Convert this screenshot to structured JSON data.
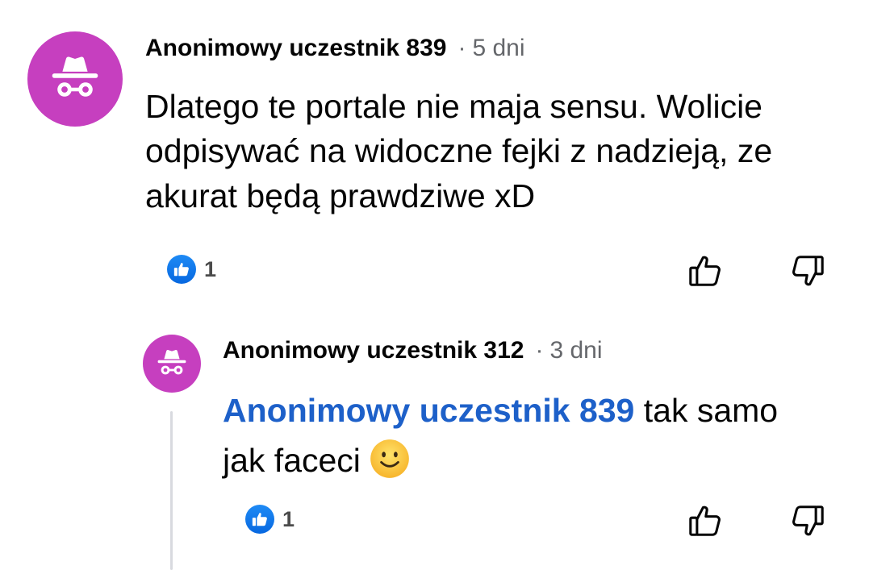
{
  "comments": [
    {
      "author": "Anonimowy uczestnik 839",
      "separator": "·",
      "time": "5 dni",
      "text": "Dlatego te portale nie maja sensu. Wolicie odpisywać na widoczne fejki z nadzieją, ze akurat będą prawdziwe xD",
      "reaction_count": "1"
    }
  ],
  "replies": [
    {
      "author": "Anonimowy uczestnik 312",
      "separator": "·",
      "time": "3 dni",
      "mention": "Anonimowy uczestnik 839",
      "text": " tak samo jak faceci",
      "emoji": "slightly-smiling-face-icon",
      "reaction_count": "1"
    }
  ],
  "icons": {
    "avatar": "incognito-icon",
    "like_badge": "thumbs-up-icon",
    "like_action": "thumbs-up-outline-icon",
    "dislike_action": "thumbs-down-outline-icon"
  },
  "colors": {
    "avatar_bg": "#c63fbf",
    "mention": "#1d60c9",
    "like_badge": "#1877f2",
    "meta": "#65676b"
  }
}
